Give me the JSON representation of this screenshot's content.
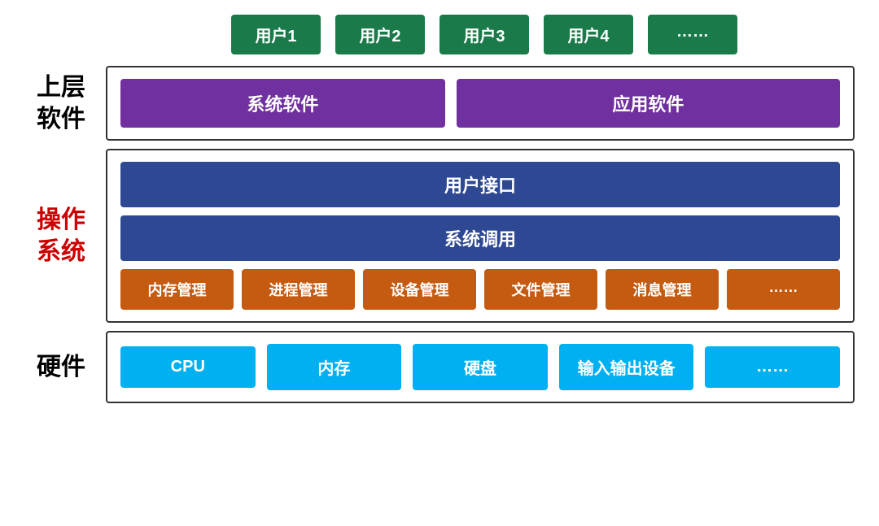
{
  "users": {
    "items": [
      {
        "label": "用户1"
      },
      {
        "label": "用户2"
      },
      {
        "label": "用户3"
      },
      {
        "label": "用户4"
      },
      {
        "label": "……"
      }
    ]
  },
  "software": {
    "label": "上层\n软件",
    "system_software": "系统软件",
    "app_software": "应用软件"
  },
  "os": {
    "label": "操作\n系统",
    "user_interface": "用户接口",
    "system_call": "系统调用",
    "modules": [
      {
        "label": "内存管理"
      },
      {
        "label": "进程管理"
      },
      {
        "label": "设备管理"
      },
      {
        "label": "文件管理"
      },
      {
        "label": "消息管理"
      },
      {
        "label": "……"
      }
    ]
  },
  "hardware": {
    "label": "硬件",
    "items": [
      {
        "label": "CPU"
      },
      {
        "label": "内存"
      },
      {
        "label": "硬盘"
      },
      {
        "label": "输入输出设备"
      },
      {
        "label": "……"
      }
    ]
  }
}
